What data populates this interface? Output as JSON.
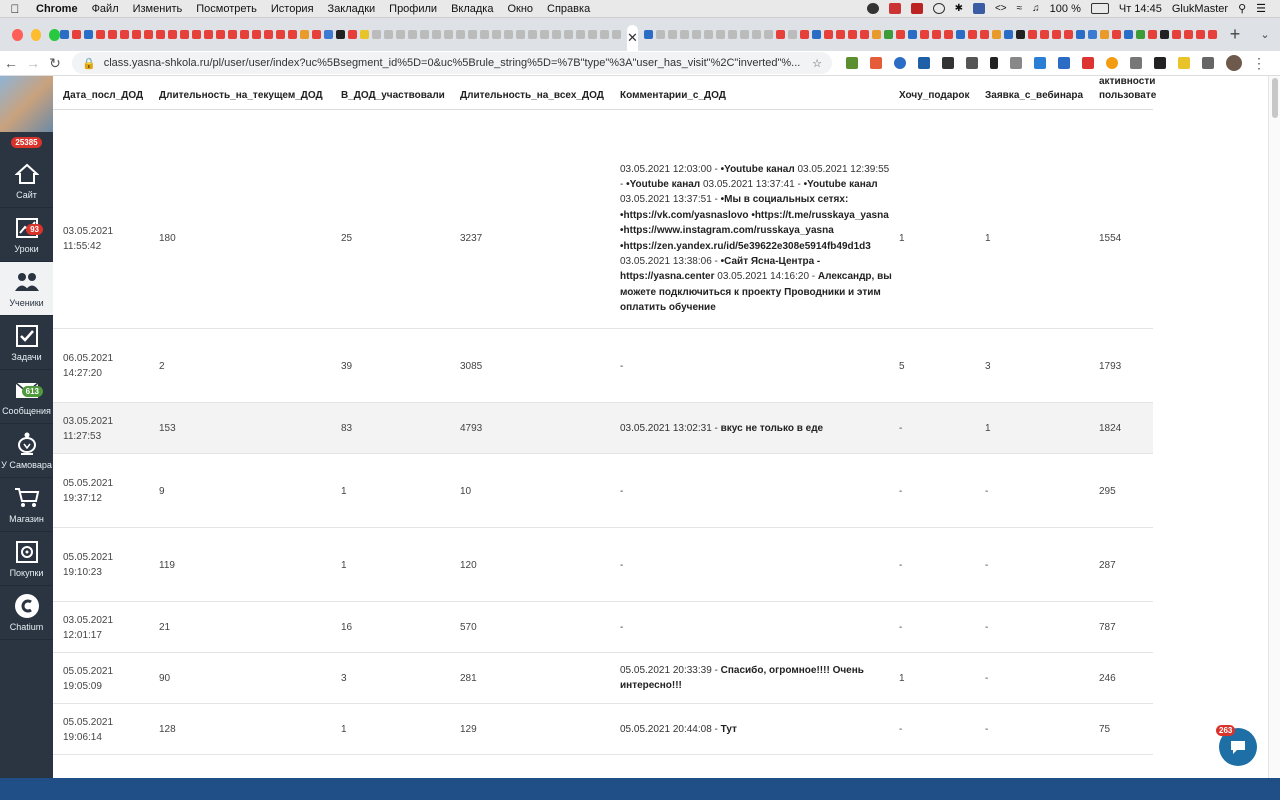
{
  "menubar": {
    "app": "Chrome",
    "items": [
      "Файл",
      "Изменить",
      "Посмотреть",
      "История",
      "Закладки",
      "Профили",
      "Вкладка",
      "Окно",
      "Справка"
    ],
    "battery": "100 %",
    "clock": "Чт 14:45",
    "user": "GlukMaster"
  },
  "browser": {
    "url": "class.yasna-shkola.ru/pl/user/user/index?uc%5Bsegment_id%5D=0&uc%5Brule_string%5D=%7B\"type\"%3A\"user_has_visit\"%2C\"inverted\"%..."
  },
  "sidebar": {
    "total_badge": "25385",
    "items": [
      {
        "label": "Сайт",
        "icon": "home-icon",
        "badge": ""
      },
      {
        "label": "Уроки",
        "icon": "chart-icon",
        "badge": "93"
      },
      {
        "label": "Ученики",
        "icon": "users-icon",
        "badge": ""
      },
      {
        "label": "Задачи",
        "icon": "checkbox-icon",
        "badge": ""
      },
      {
        "label": "Сообщения",
        "icon": "envelope-icon",
        "badge": "613"
      },
      {
        "label": "У Самовара",
        "icon": "samovar-icon",
        "badge": ""
      },
      {
        "label": "Магазин",
        "icon": "cart-icon",
        "badge": ""
      },
      {
        "label": "Покупки",
        "icon": "safe-icon",
        "badge": ""
      },
      {
        "label": "Chatium",
        "icon": "chatium-icon",
        "badge": ""
      }
    ]
  },
  "table": {
    "headers": {
      "date": "Дата_посл_ДОД",
      "duration_current": "Длительность_на_текущем_ДОД",
      "participated": "В_ДОД_участвовали",
      "duration_all": "Длительность_на_всех_ДОД",
      "comments": "Комментарии_с_ДОД",
      "want_gift": "Хочу_подарок",
      "webinar_request": "Заявка_с_вебинара",
      "activity_top": "активности",
      "activity": "пользовате"
    },
    "rows": [
      {
        "date_line1": "03.05.2021",
        "date_line2": "11:55:42",
        "duration_current": "180",
        "participated": "25",
        "duration_all": "3237",
        "comment_parts": [
          {
            "t": "03.05.2021 12:03:00 - ",
            "b": false
          },
          {
            "t": "•Youtube канал",
            "b": true
          },
          {
            "t": " 03.05.2021 12:39:55 - ",
            "b": false
          },
          {
            "t": "•Youtube канал",
            "b": true
          },
          {
            "t": " 03.05.2021 13:37:41 - ",
            "b": false
          },
          {
            "t": "•Youtube канал",
            "b": true
          },
          {
            "t": " 03.05.2021 13:37:51 - ",
            "b": false
          },
          {
            "t": "•Мы в социальных сетях: •https://vk.com/yasnaslovo •https://t.me/russkaya_yasna •https://www.instagram.com/russkaya_yasna •https://zen.yandex.ru/id/5e39622e308e5914fb49d1d3",
            "b": true
          },
          {
            "t": " 03.05.2021 13:38:06 - ",
            "b": false
          },
          {
            "t": "•Сайт Ясна-Центра - https://yasna.center",
            "b": true
          },
          {
            "t": " 03.05.2021 14:16:20 - ",
            "b": false
          },
          {
            "t": "Александр, вы можете подключиться к проекту Проводники и этим оплатить обучение",
            "b": true
          }
        ],
        "want_gift": "1",
        "webinar_request": "1",
        "activity": "1554"
      },
      {
        "date_line1": "06.05.2021",
        "date_line2": "14:27:20",
        "duration_current": "2",
        "participated": "39",
        "duration_all": "3085",
        "comment_parts": [
          {
            "t": "-",
            "b": false
          }
        ],
        "want_gift": "5",
        "webinar_request": "3",
        "activity": "1793"
      },
      {
        "date_line1": "03.05.2021",
        "date_line2": "11:27:53",
        "duration_current": "153",
        "participated": "83",
        "duration_all": "4793",
        "comment_parts": [
          {
            "t": "03.05.2021 13:02:31 - ",
            "b": false
          },
          {
            "t": "вкус не только в еде",
            "b": true
          }
        ],
        "want_gift": "-",
        "webinar_request": "1",
        "activity": "1824"
      },
      {
        "date_line1": "05.05.2021",
        "date_line2": "19:37:12",
        "duration_current": "9",
        "participated": "1",
        "duration_all": "10",
        "comment_parts": [
          {
            "t": "-",
            "b": false
          }
        ],
        "want_gift": "-",
        "webinar_request": "-",
        "activity": "295"
      },
      {
        "date_line1": "05.05.2021",
        "date_line2": "19:10:23",
        "duration_current": "119",
        "participated": "1",
        "duration_all": "120",
        "comment_parts": [
          {
            "t": "-",
            "b": false
          }
        ],
        "want_gift": "-",
        "webinar_request": "-",
        "activity": "287"
      },
      {
        "date_line1": "03.05.2021",
        "date_line2": "12:01:17",
        "duration_current": "21",
        "participated": "16",
        "duration_all": "570",
        "comment_parts": [
          {
            "t": "-",
            "b": false
          }
        ],
        "want_gift": "-",
        "webinar_request": "-",
        "activity": "787"
      },
      {
        "date_line1": "05.05.2021",
        "date_line2": "19:05:09",
        "duration_current": "90",
        "participated": "3",
        "duration_all": "281",
        "comment_parts": [
          {
            "t": "05.05.2021 20:33:39 - ",
            "b": false
          },
          {
            "t": "Спасибо, огромное!!!! Очень интересно!!!",
            "b": true
          }
        ],
        "want_gift": "1",
        "webinar_request": "-",
        "activity": "246"
      },
      {
        "date_line1": "05.05.2021",
        "date_line2": "19:06:14",
        "duration_current": "128",
        "participated": "1",
        "duration_all": "129",
        "comment_parts": [
          {
            "t": "05.05.2021 20:44:08 - ",
            "b": false
          },
          {
            "t": "Тут",
            "b": true
          }
        ],
        "want_gift": "-",
        "webinar_request": "-",
        "activity": "75"
      }
    ]
  },
  "chat": {
    "badge": "263"
  },
  "colors": {
    "sidebar_bg": "#2a3541",
    "badge_red": "#d9342b",
    "badge_green": "#4f9a3c",
    "page_bg": "#1f4f86",
    "chat_bubble": "#1d6fa5"
  }
}
